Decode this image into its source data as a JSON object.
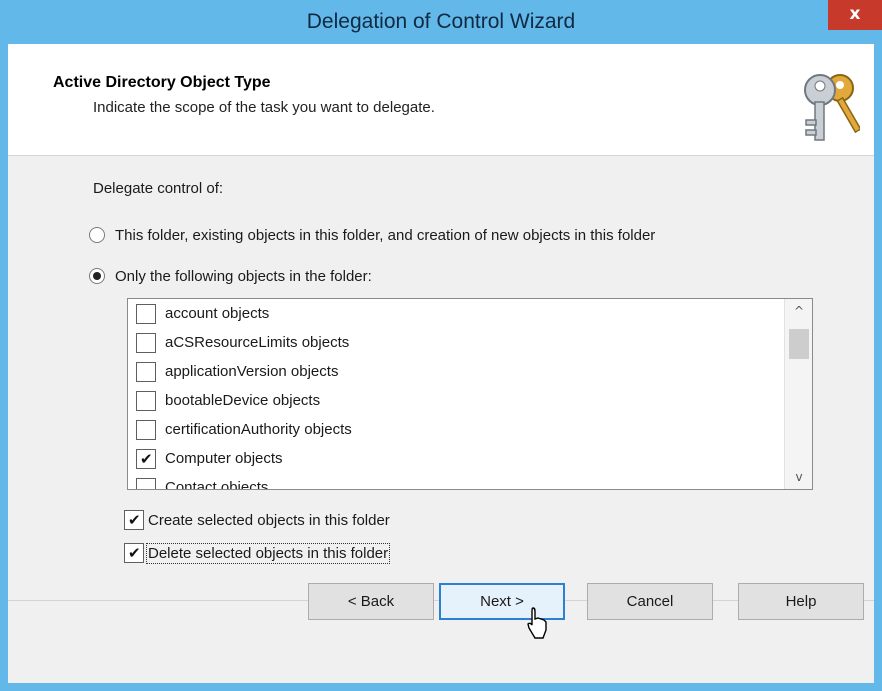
{
  "window": {
    "title": "Delegation of Control Wizard",
    "close_glyph": "x",
    "close_color": "#c7392b",
    "frame_color": "#62b8e8"
  },
  "header": {
    "title": "Active Directory Object Type",
    "subtitle": "Indicate the scope of the task you want to delegate.",
    "icon": "keys-icon"
  },
  "delegate": {
    "label": "Delegate control of:",
    "options": [
      {
        "label": "This folder, existing objects in this folder, and creation of new objects in this folder",
        "selected": false
      },
      {
        "label": "Only the following objects in the folder:",
        "selected": true
      }
    ]
  },
  "object_list": {
    "items": [
      {
        "label": "account objects",
        "checked": false
      },
      {
        "label": "aCSResourceLimits objects",
        "checked": false
      },
      {
        "label": "applicationVersion objects",
        "checked": false
      },
      {
        "label": "bootableDevice objects",
        "checked": false
      },
      {
        "label": "certificationAuthority objects",
        "checked": false
      },
      {
        "label": "Computer objects",
        "checked": true
      },
      {
        "label": "Contact objects",
        "checked": false
      }
    ],
    "scroll_up_glyph": "^",
    "scroll_down_glyph": "v"
  },
  "options": {
    "create": {
      "label": "Create selected objects in this folder",
      "checked": true
    },
    "delete": {
      "label": "Delete selected objects in this folder",
      "checked": true
    }
  },
  "buttons": {
    "back": "< Back",
    "next": "Next >",
    "cancel": "Cancel",
    "help": "Help"
  },
  "check_glyph": "✔"
}
